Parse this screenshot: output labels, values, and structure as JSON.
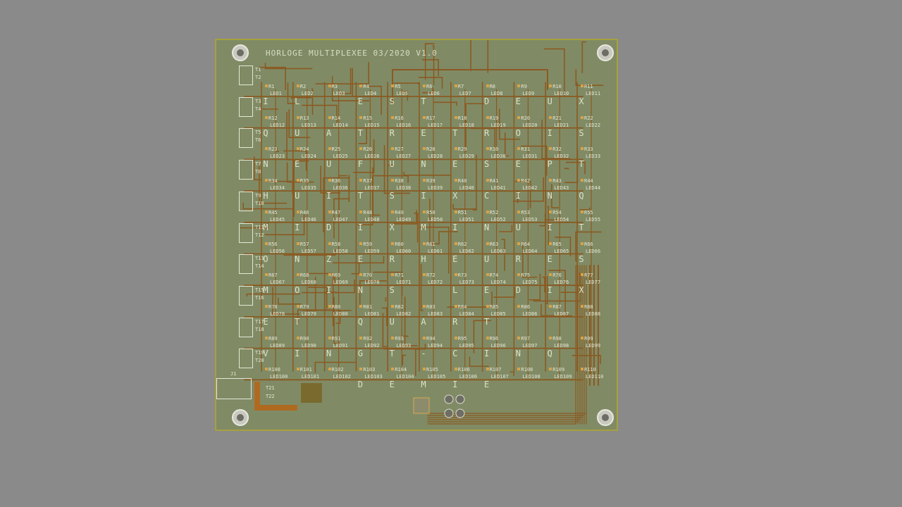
{
  "board": {
    "title": "HORLOGE MULTIPLEXEE 03/2020 V1.0",
    "colors": {
      "pcb": "#808b65",
      "edge": "#a7a13b",
      "track": "#8a5a22",
      "silk": "#e4e6d4",
      "background": "#8a8a8a"
    }
  },
  "letter_grid": [
    [
      "I",
      "L",
      "",
      "E",
      "S",
      "T",
      "",
      "D",
      "E",
      "U",
      "X"
    ],
    [
      "Q",
      "U",
      "A",
      "T",
      "R",
      "E",
      "T",
      "R",
      "O",
      "I",
      "S"
    ],
    [
      "N",
      "E",
      "U",
      "F",
      "U",
      "N",
      "E",
      "S",
      "E",
      "P",
      "T"
    ],
    [
      "H",
      "U",
      "I",
      "T",
      "S",
      "I",
      "X",
      "C",
      "I",
      "N",
      "Q"
    ],
    [
      "M",
      "I",
      "D",
      "I",
      "X",
      "M",
      "I",
      "N",
      "U",
      "I",
      "T"
    ],
    [
      "O",
      "N",
      "Z",
      "E",
      "R",
      "H",
      "E",
      "U",
      "R",
      "E",
      "S"
    ],
    [
      "M",
      "O",
      "I",
      "N",
      "S",
      "",
      "L",
      "E",
      "D",
      "I",
      "X"
    ],
    [
      "E",
      "T",
      "",
      "Q",
      "U",
      "A",
      "R",
      "T",
      "",
      "",
      ""
    ],
    [
      "V",
      "I",
      "N",
      "G",
      "T",
      "-",
      "C",
      "I",
      "N",
      "Q",
      ""
    ],
    [
      "",
      "",
      "",
      "D",
      "E",
      "M",
      "I",
      "E",
      "",
      "",
      ""
    ]
  ],
  "labels": {
    "resistors": [
      [
        "R1",
        "R2",
        "R3",
        "R4",
        "R5",
        "R6",
        "R7",
        "R8",
        "R9",
        "R10",
        "R11"
      ],
      [
        "R12",
        "R13",
        "R14",
        "R15",
        "R16",
        "R17",
        "R18",
        "R19",
        "R20",
        "R21",
        "R22"
      ],
      [
        "R23",
        "R24",
        "R25",
        "R26",
        "R27",
        "R28",
        "R29",
        "R30",
        "R31",
        "R32",
        "R33"
      ],
      [
        "R34",
        "R35",
        "R36",
        "R37",
        "R38",
        "R39",
        "R40",
        "R41",
        "R42",
        "R43",
        "R44"
      ],
      [
        "R45",
        "R46",
        "R47",
        "R48",
        "R49",
        "R50",
        "R51",
        "R52",
        "R53",
        "R54",
        "R55"
      ],
      [
        "R56",
        "R57",
        "R58",
        "R59",
        "R60",
        "R61",
        "R62",
        "R63",
        "R64",
        "R65",
        "R66"
      ],
      [
        "R67",
        "R68",
        "R69",
        "R70",
        "R71",
        "R72",
        "R73",
        "R74",
        "R75",
        "R76",
        "R77"
      ],
      [
        "R78",
        "R79",
        "R80",
        "R81",
        "R82",
        "R83",
        "R84",
        "R85",
        "R86",
        "R87",
        "R88"
      ],
      [
        "R89",
        "R90",
        "R91",
        "R92",
        "R93",
        "R94",
        "R95",
        "R96",
        "R97",
        "R98",
        "R99"
      ],
      [
        "R100",
        "R101",
        "R102",
        "R103",
        "R104",
        "R105",
        "R106",
        "R107",
        "R108",
        "R109",
        "R110"
      ]
    ],
    "leds": [
      [
        "LED1",
        "LED2",
        "LED3",
        "LED4",
        "LED5",
        "LED6",
        "LED7",
        "LED8",
        "LED9",
        "LED10",
        "LED11"
      ],
      [
        "LED12",
        "LED13",
        "LED14",
        "LED15",
        "LED16",
        "LED17",
        "LED18",
        "LED19",
        "LED20",
        "LED21",
        "LED22"
      ],
      [
        "LED23",
        "LED24",
        "LED25",
        "LED26",
        "LED27",
        "LED28",
        "LED29",
        "LED30",
        "LED31",
        "LED32",
        "LED33"
      ],
      [
        "LED34",
        "LED35",
        "LED36",
        "LED37",
        "LED38",
        "LED39",
        "LED40",
        "LED41",
        "LED42",
        "LED43",
        "LED44"
      ],
      [
        "LED45",
        "LED46",
        "LED47",
        "LED48",
        "LED49",
        "LED50",
        "LED51",
        "LED52",
        "LED53",
        "LED54",
        "LED55"
      ],
      [
        "LED56",
        "LED57",
        "LED58",
        "LED59",
        "LED60",
        "LED61",
        "LED62",
        "LED63",
        "LED64",
        "LED65",
        "LED66"
      ],
      [
        "LED67",
        "LED68",
        "LED69",
        "LED70",
        "LED71",
        "LED72",
        "LED73",
        "LED74",
        "LED75",
        "LED76",
        "LED77"
      ],
      [
        "LED78",
        "LED79",
        "LED80",
        "LED81",
        "LED82",
        "LED83",
        "LED84",
        "LED85",
        "LED86",
        "LED87",
        "LED88"
      ],
      [
        "LED89",
        "LED90",
        "LED91",
        "LED92",
        "LED93",
        "LED94",
        "LED95",
        "LED96",
        "LED97",
        "LED98",
        "LED99"
      ],
      [
        "LED100",
        "LED101",
        "LED102",
        "LED103",
        "LED104",
        "LED105",
        "LED106",
        "LED107",
        "LED108",
        "LED109",
        "LED110"
      ]
    ],
    "transistors": [
      "T1",
      "T2",
      "T3",
      "T4",
      "T5",
      "T6",
      "T7",
      "T8",
      "T9",
      "T10",
      "T11",
      "T12",
      "T13",
      "T14",
      "T15",
      "T16",
      "T17",
      "T18",
      "T19",
      "T20",
      "T21",
      "T22"
    ],
    "connector": "J1"
  }
}
